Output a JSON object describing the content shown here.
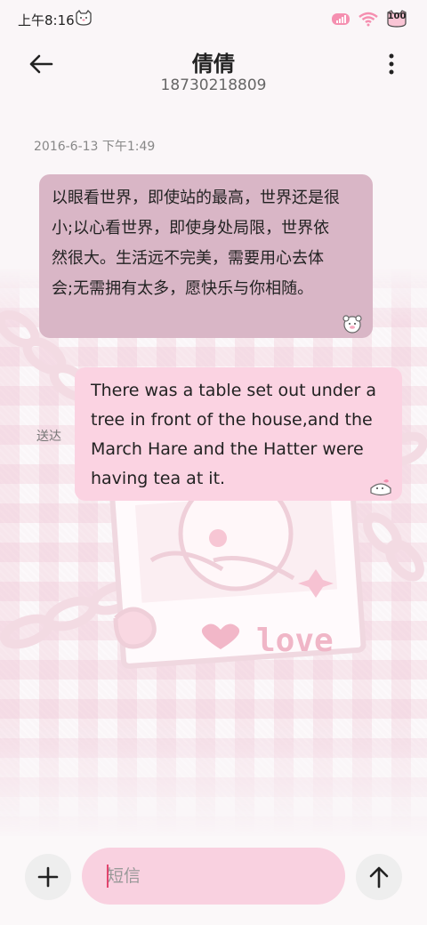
{
  "status_bar": {
    "time": "上午8:16",
    "battery": "100"
  },
  "header": {
    "title": "倩倩",
    "subtitle": "18730218809"
  },
  "conversation": {
    "timestamp": "2016-6-13 下午1:49",
    "messages": [
      {
        "direction": "received",
        "text": "以眼看世界，即使站的最高，世界还是很小;以心看世界，即使身处局限，世界依然很大。生活远不完美，需要用心去体会;无需拥有太多，愿快乐与你相随。"
      },
      {
        "direction": "sent",
        "status": "送达",
        "text": "There was a table set out under a tree in front of the house,and the March Hare and the Hatter were having tea at it."
      }
    ]
  },
  "composer": {
    "placeholder": "短信",
    "add_icon": "plus-icon",
    "send_icon": "arrow-up-icon"
  },
  "colors": {
    "received_bubble": "#d9b6c6",
    "sent_bubble": "#fbd3e2",
    "input_bg": "#f9d1e0",
    "accent": "#e2456e"
  }
}
